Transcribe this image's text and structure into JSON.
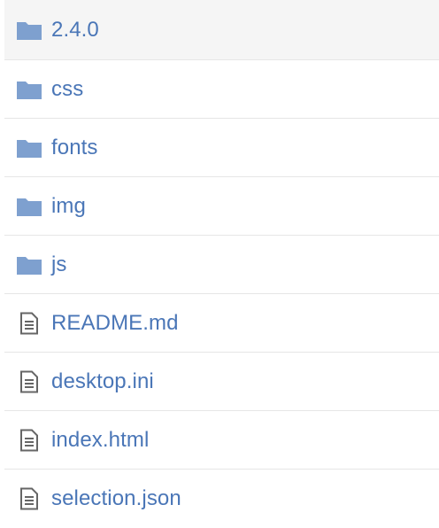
{
  "colors": {
    "link": "#4a76b7",
    "folder_icon": "#7ea0cf",
    "file_icon": "#666666",
    "row_highlight": "#f5f5f5",
    "divider": "#e6e6e6"
  },
  "items": [
    {
      "name": "2.4.0",
      "type": "folder",
      "icon": "folder-icon"
    },
    {
      "name": "css",
      "type": "folder",
      "icon": "folder-icon"
    },
    {
      "name": "fonts",
      "type": "folder",
      "icon": "folder-icon"
    },
    {
      "name": "img",
      "type": "folder",
      "icon": "folder-icon"
    },
    {
      "name": "js",
      "type": "folder",
      "icon": "folder-icon"
    },
    {
      "name": "README.md",
      "type": "file",
      "icon": "file-icon"
    },
    {
      "name": "desktop.ini",
      "type": "file",
      "icon": "file-icon"
    },
    {
      "name": "index.html",
      "type": "file",
      "icon": "file-icon"
    },
    {
      "name": "selection.json",
      "type": "file",
      "icon": "file-icon"
    }
  ]
}
